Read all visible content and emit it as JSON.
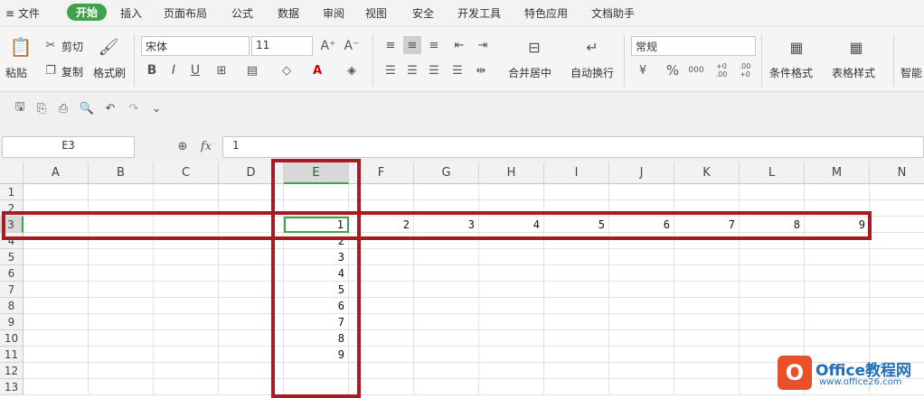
{
  "menubar": {
    "items": [
      "≡ 文件",
      "开始",
      "插入",
      "页面布局",
      "公式",
      "数据",
      "审阅",
      "视图",
      "安全",
      "开发工具",
      "特色应用",
      "文档助手"
    ],
    "active_index": 1,
    "active_color": "#3fa34d"
  },
  "ribbon": {
    "paste": "粘贴",
    "cut": "剪切",
    "copy": "复制",
    "format_painter": "格式刷",
    "font_name": "宋体",
    "font_size": "11",
    "grow_font": "A⁺",
    "shrink_font": "A⁻",
    "bold": "B",
    "italic": "I",
    "underline": "U",
    "merge_center": "合并居中",
    "wrap_text": "自动换行",
    "number_format": "常规",
    "currency": "¥",
    "percent": "%",
    "thousands": "000",
    "inc_decimal": "+0 .00",
    "dec_decimal": ".00 +0",
    "conditional_format": "条件格式",
    "table_style": "表格样式",
    "smart": "智能"
  },
  "formula_bar": {
    "name_box": "E3",
    "fx": "fx",
    "value": "1"
  },
  "sheet": {
    "columns": [
      "A",
      "B",
      "C",
      "D",
      "E",
      "F",
      "G",
      "H",
      "I",
      "J",
      "K",
      "L",
      "M",
      "N"
    ],
    "rows": [
      "1",
      "2",
      "3",
      "4",
      "5",
      "6",
      "7",
      "8",
      "9",
      "10",
      "11",
      "12",
      "13"
    ],
    "selected_cell": "E3",
    "row3_values": [
      "1",
      "2",
      "3",
      "4",
      "5",
      "6",
      "7",
      "8",
      "9"
    ],
    "colE_values": [
      "2",
      "3",
      "4",
      "5",
      "6",
      "7",
      "8",
      "9"
    ],
    "highlight_color": "#a51d23"
  },
  "watermark": {
    "brand": "Office教程网",
    "url": "www.office26.com"
  }
}
